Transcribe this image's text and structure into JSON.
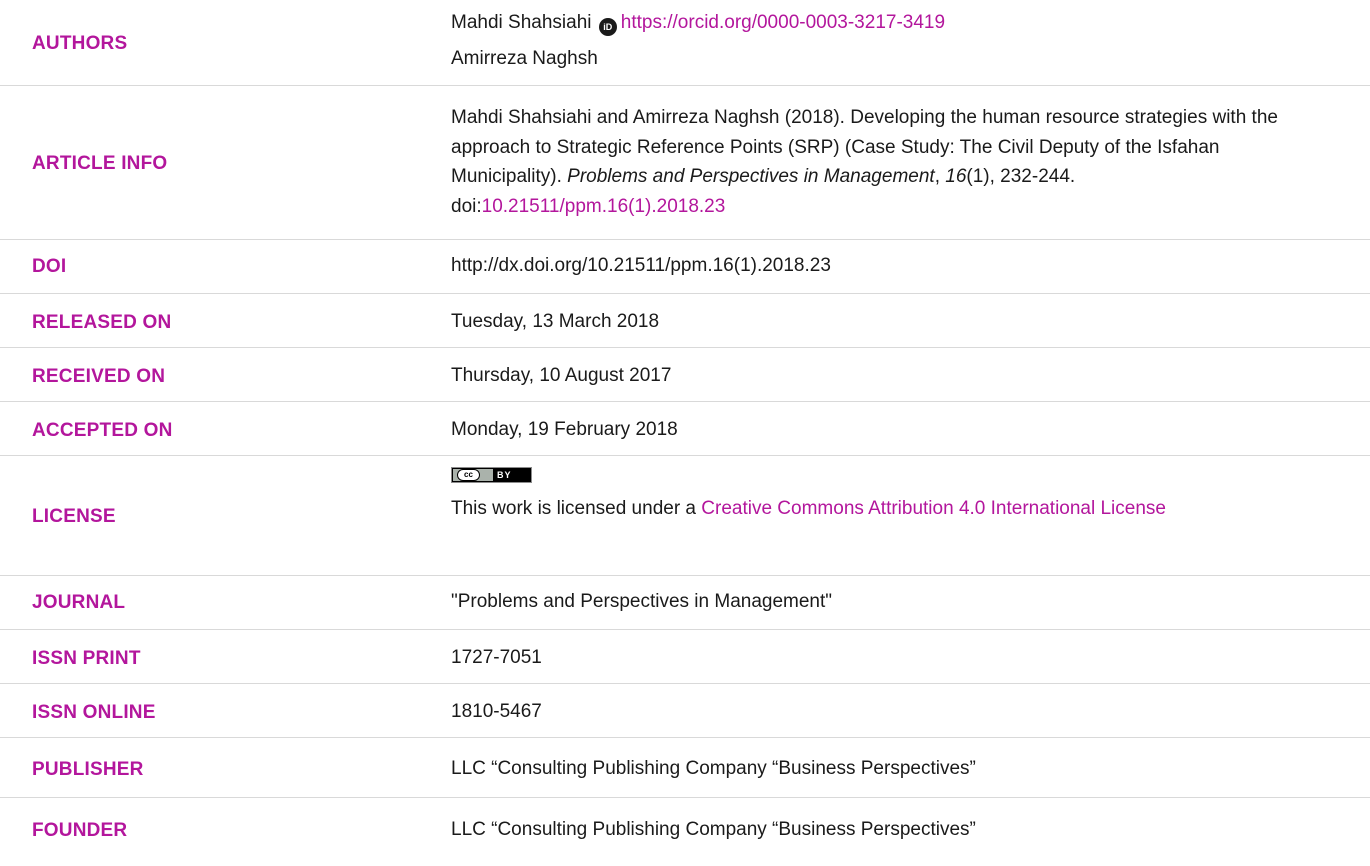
{
  "authors": {
    "label": "AUTHORS",
    "name1": "Mahdi Shahsiahi",
    "orcid_icon_text": "iD",
    "orcid_url": "https://orcid.org/0000-0003-3217-3419",
    "name2": "Amirreza Naghsh"
  },
  "article_info": {
    "label": "ARTICLE INFO",
    "citation_prefix": "Mahdi Shahsiahi and Amirreza Naghsh (2018). Developing the human resource strategies with the approach to Strategic Reference Points (SRP) (Case Study: The Civil Deputy of the Isfahan Municipality). ",
    "journal_italic": "Problems and Perspectives in Management",
    "comma1": ", ",
    "volume_italic": "16",
    "issue_pages": "(1), 232-244. doi:",
    "doi_link": "10.21511/ppm.16(1).2018.23"
  },
  "doi": {
    "label": "DOI",
    "value": "http://dx.doi.org/10.21511/ppm.16(1).2018.23"
  },
  "released": {
    "label": "RELEASED ON",
    "value": "Tuesday, 13 March 2018"
  },
  "received": {
    "label": "RECEIVED ON",
    "value": "Thursday, 10 August 2017"
  },
  "accepted": {
    "label": "ACCEPTED ON",
    "value": "Monday, 19 February 2018"
  },
  "license": {
    "label": "LICENSE",
    "badge_cc": "cc",
    "badge_by": "BY",
    "text_prefix": "This work is licensed under a ",
    "link_text": "Creative Commons Attribution 4.0 International License"
  },
  "journal": {
    "label": "JOURNAL",
    "value": "\"Problems and Perspectives in Management\""
  },
  "issn_print": {
    "label": "ISSN PRINT",
    "value": "1727-7051"
  },
  "issn_online": {
    "label": "ISSN ONLINE",
    "value": "1810-5467"
  },
  "publisher": {
    "label": "PUBLISHER",
    "value": "LLC “Consulting Publishing Company “Business Perspectives”"
  },
  "founder": {
    "label": "FOUNDER",
    "value": "LLC “Consulting Publishing Company “Business Perspectives”"
  },
  "colors": {
    "label": "#b3169c",
    "text": "#1a1a1a",
    "divider": "#d9d9d9"
  }
}
